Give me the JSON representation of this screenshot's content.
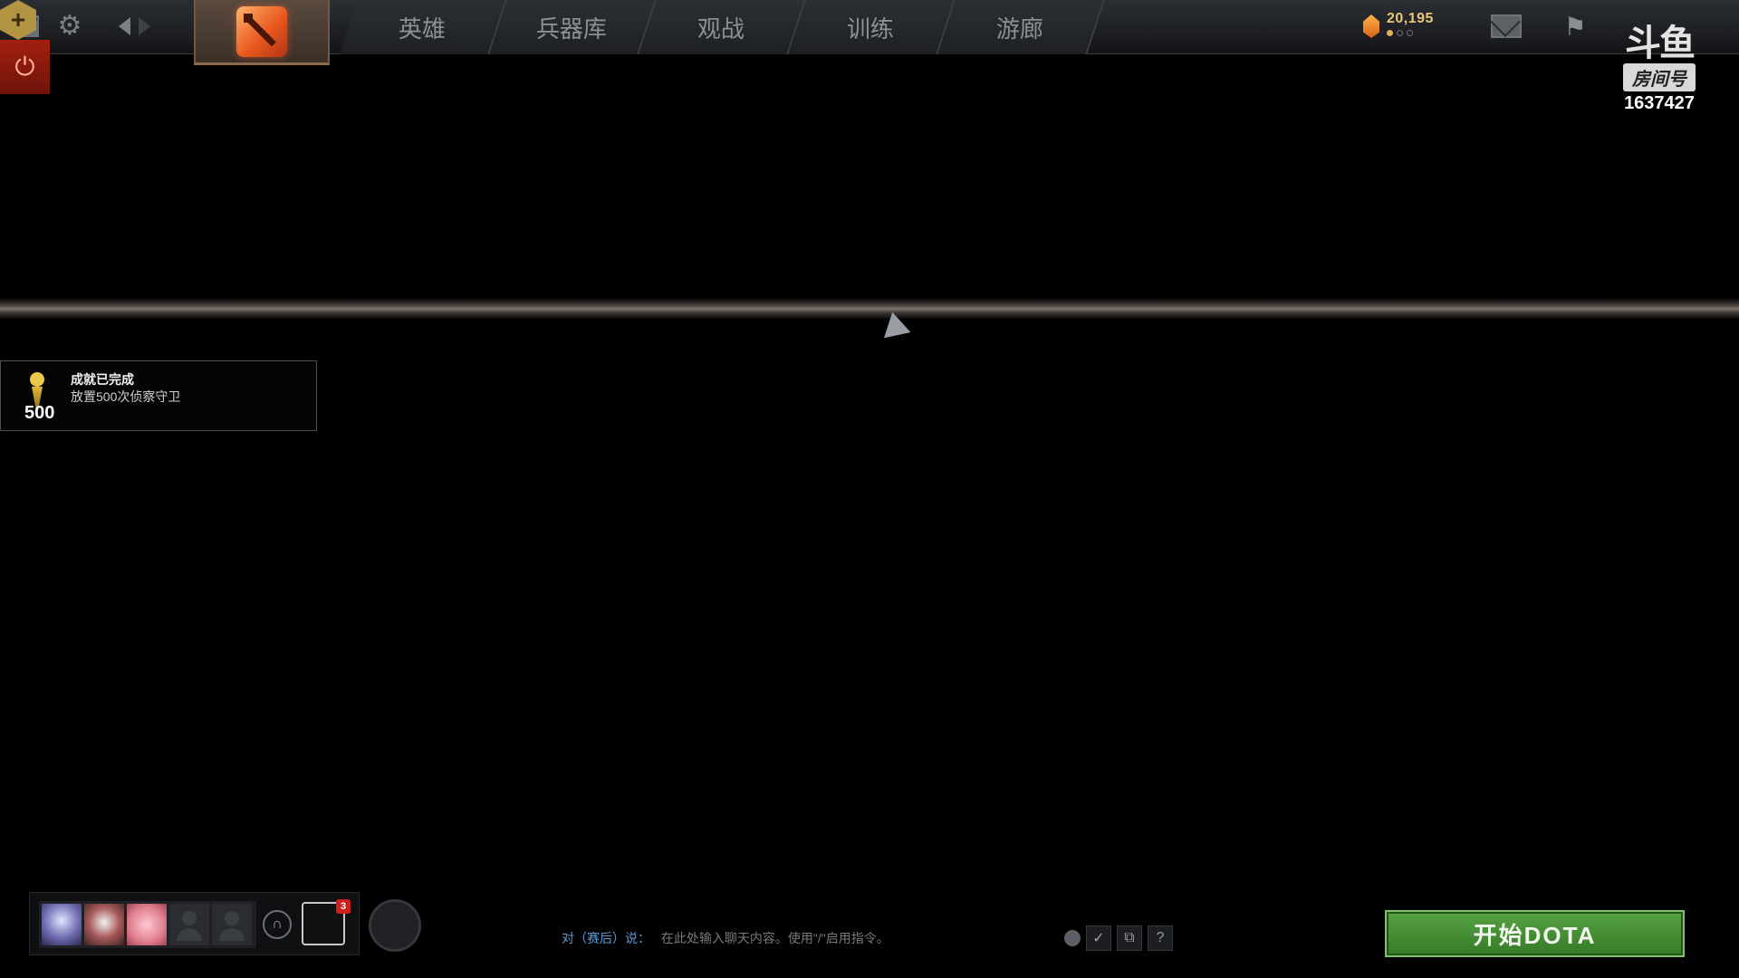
{
  "nav": {
    "items": [
      {
        "label": "英雄"
      },
      {
        "label": "兵器库"
      },
      {
        "label": "观战"
      },
      {
        "label": "训练"
      },
      {
        "label": "游廊"
      }
    ]
  },
  "currency": {
    "shards": "20,195",
    "dots_filled": 1,
    "dots_total": 3
  },
  "watermark": {
    "logo": "斗鱼",
    "label": "房间号",
    "room_number": "1637427"
  },
  "achievement": {
    "count": "500",
    "title": "成就已完成",
    "description": "放置500次侦察守卫"
  },
  "party": {
    "notification_count": "3"
  },
  "chat": {
    "label": "对（赛后）说：",
    "placeholder": "在此处输入聊天内容。使用\"/\"启用指令。",
    "help": "?"
  },
  "play_button": {
    "label": "开始DOTA"
  },
  "colors": {
    "accent_gold": "#e8c77a",
    "play_green": "#4a9339",
    "power_red": "#a3200f",
    "chat_blue": "#5a9ad6"
  }
}
